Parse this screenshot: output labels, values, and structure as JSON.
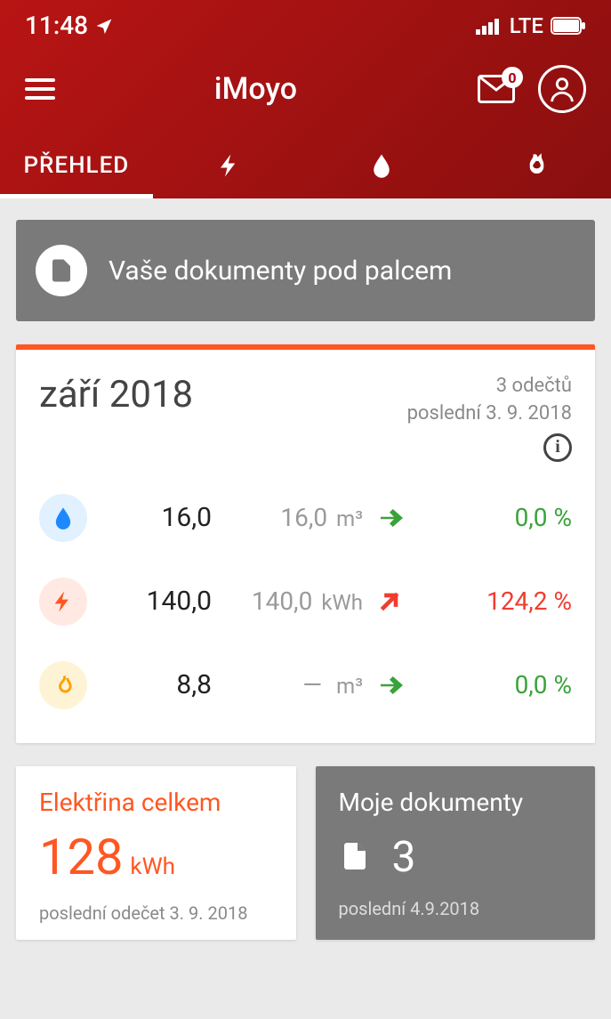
{
  "status": {
    "time": "11:48",
    "network": "LTE"
  },
  "header": {
    "app_title": "iMoyo",
    "mail_badge": "0"
  },
  "tabs": {
    "overview": "PŘEHLED"
  },
  "banner": {
    "text": "Vaše dokumenty pod palcem"
  },
  "summary": {
    "title": "září 2018",
    "meta_count": "3 odečtů",
    "meta_last": "poslední 3. 9. 2018",
    "rows": [
      {
        "value": "16,0",
        "alt": "16,0",
        "unit": "m³",
        "pct": "0,0 %"
      },
      {
        "value": "140,0",
        "alt": "140,0",
        "unit": "kWh",
        "pct": "124,2 %"
      },
      {
        "value": "8,8",
        "alt": "—",
        "unit": "m³",
        "pct": "0,0 %"
      }
    ]
  },
  "elec_card": {
    "title": "Elektřina celkem",
    "value": "128",
    "unit": "kWh",
    "sub": "poslední odečet 3. 9. 2018"
  },
  "docs_card": {
    "title": "Moje dokumenty",
    "count": "3",
    "sub": "poslední 4.9.2018"
  }
}
